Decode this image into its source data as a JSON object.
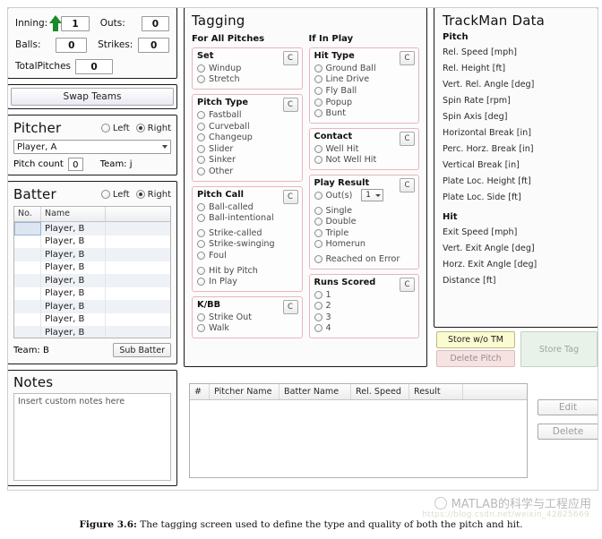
{
  "status": {
    "inning_label": "Inning:",
    "inning_value": "1",
    "outs_label": "Outs:",
    "outs_value": "0",
    "balls_label": "Balls:",
    "balls_value": "0",
    "strikes_label": "Strikes:",
    "strikes_value": "0",
    "total_pitches_label": "TotalPitches",
    "total_pitches_value": "0",
    "inning_arrow": "up-arrow-icon"
  },
  "swap_teams_label": "Swap Teams",
  "pitcher": {
    "title": "Pitcher",
    "left_label": "Left",
    "right_label": "Right",
    "handedness_selected": "Right",
    "selected_player": "Player, A",
    "pitch_count_label": "Pitch count",
    "pitch_count_value": "0",
    "team_label": "Team: j"
  },
  "batter": {
    "title": "Batter",
    "left_label": "Left",
    "right_label": "Right",
    "handedness_selected": "Right",
    "columns": [
      "No.",
      "Name",
      ""
    ],
    "rows": [
      {
        "no": "",
        "name": "Player, B"
      },
      {
        "no": "",
        "name": "Player, B"
      },
      {
        "no": "",
        "name": "Player, B"
      },
      {
        "no": "",
        "name": "Player, B"
      },
      {
        "no": "",
        "name": "Player, B"
      },
      {
        "no": "",
        "name": "Player, B"
      },
      {
        "no": "",
        "name": "Player, B"
      },
      {
        "no": "",
        "name": "Player, B"
      },
      {
        "no": "",
        "name": "Player, B"
      }
    ],
    "team_label": "Team:  B",
    "sub_batter_label": "Sub Batter"
  },
  "notes": {
    "title": "Notes",
    "placeholder": "Insert custom notes here"
  },
  "tagging": {
    "title": "Tagging",
    "col_all_pitches": "For All Pitches",
    "col_in_play": "If In Play",
    "clear_button": "C",
    "groups_all": [
      {
        "title": "Set",
        "options": [
          "Windup",
          "Stretch"
        ]
      },
      {
        "title": "Pitch Type",
        "options": [
          "Fastball",
          "Curveball",
          "Changeup",
          "Slider",
          "Sinker",
          "Other"
        ]
      },
      {
        "title": "Pitch Call",
        "options": [
          "Ball-called",
          "Ball-intentional",
          "",
          "Strike-called",
          "Strike-swinging",
          "Foul",
          "",
          "Hit by Pitch",
          "In Play"
        ]
      },
      {
        "title": "K/BB",
        "options": [
          "Strike Out",
          "Walk"
        ]
      }
    ],
    "groups_play": [
      {
        "title": "Hit Type",
        "options": [
          "Ground Ball",
          "Line Drive",
          "Fly Ball",
          "Popup",
          "Bunt"
        ]
      },
      {
        "title": "Contact",
        "options": [
          "Well Hit",
          "Not Well Hit"
        ]
      },
      {
        "title": "Play Result",
        "options": [
          "Out(s)",
          "",
          "Single",
          "Double",
          "Triple",
          "Homerun",
          "",
          "Reached on Error"
        ],
        "outs_dropdown_value": "1"
      },
      {
        "title": "Runs Scored",
        "options": [
          "1",
          "2",
          "3",
          "4"
        ]
      }
    ]
  },
  "trackman": {
    "title": "TrackMan Data",
    "pitch_header": "Pitch",
    "pitch_fields": [
      "Rel. Speed [mph]",
      "Rel. Height [ft]",
      "Vert. Rel. Angle [deg]",
      "Spin Rate [rpm]",
      "Spin Axis [deg]",
      "Horizontal Break [in]",
      "Perc. Horz. Break [in]",
      "Vertical Break [in]",
      "Plate Loc. Height [ft]",
      "Plate Loc. Side [ft]"
    ],
    "hit_header": "Hit",
    "hit_fields": [
      "Exit Speed [mph]",
      "Vert. Exit Angle [deg]",
      "Horz. Exit Angle [deg]",
      "Distance [ft]"
    ],
    "store_wo_tm_label": "Store w/o TM",
    "delete_pitch_label": "Delete Pitch",
    "store_tag_label": "Store Tag"
  },
  "pitch_table": {
    "columns": [
      "#",
      "Pitcher Name",
      "Batter Name",
      "Rel. Speed",
      "Result",
      ""
    ],
    "rows": [],
    "edit_label": "Edit",
    "delete_label": "Delete"
  },
  "caption": {
    "figure_number": "Figure 3.6:",
    "text": " The tagging screen used to define the type and quality of both the pitch and hit."
  },
  "watermark": {
    "text": "MATLAB的科学与工程应用",
    "url": "https://blog.csdn.net/weixin_42825669"
  },
  "colors": {
    "fieldset_border": "#e7b6bc",
    "accent_arrow": "#1b8a2a",
    "store_yellow": "#fbfbd0",
    "delete_pink": "#f7e2e2",
    "store_tag_green": "#e9f2e9"
  }
}
